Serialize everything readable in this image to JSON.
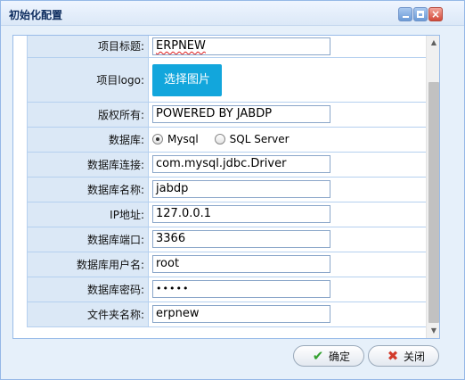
{
  "window": {
    "title": "初始化配置",
    "tools": {
      "minimize_icon": "minimize-icon",
      "maximize_icon": "maximize-icon",
      "close_icon": "close-icon",
      "close_glyph": "×"
    }
  },
  "form": {
    "fields": {
      "project_title": {
        "label": "项目标题:",
        "value": "ERPNEW"
      },
      "project_logo": {
        "label": "项目logo:",
        "button": "选择图片"
      },
      "copyright": {
        "label": "版权所有:",
        "value": "POWERED BY JABDP"
      },
      "database": {
        "label": "数据库:",
        "options": [
          "Mysql",
          "SQL Server"
        ],
        "selected": "Mysql"
      },
      "db_connection": {
        "label": "数据库连接:",
        "value": "com.mysql.jdbc.Driver"
      },
      "db_name": {
        "label": "数据库名称:",
        "value": "jabdp"
      },
      "ip": {
        "label": "IP地址:",
        "value": "127.0.0.1"
      },
      "db_port": {
        "label": "数据库端口:",
        "value": "3366"
      },
      "db_user": {
        "label": "数据库用户名:",
        "value": "root"
      },
      "db_password": {
        "label": "数据库密码:",
        "value": "•••••"
      },
      "folder_name": {
        "label": "文件夹名称:",
        "value": "erpnew"
      }
    }
  },
  "footer": {
    "ok_label": "确定",
    "cancel_label": "关闭"
  },
  "colors": {
    "title_text": "#0e2d5f",
    "label_bg": "#dbe8f6",
    "pick_button": "#12a6dc",
    "ok_icon": "#33a12f",
    "cancel_icon": "#d23a2b"
  }
}
